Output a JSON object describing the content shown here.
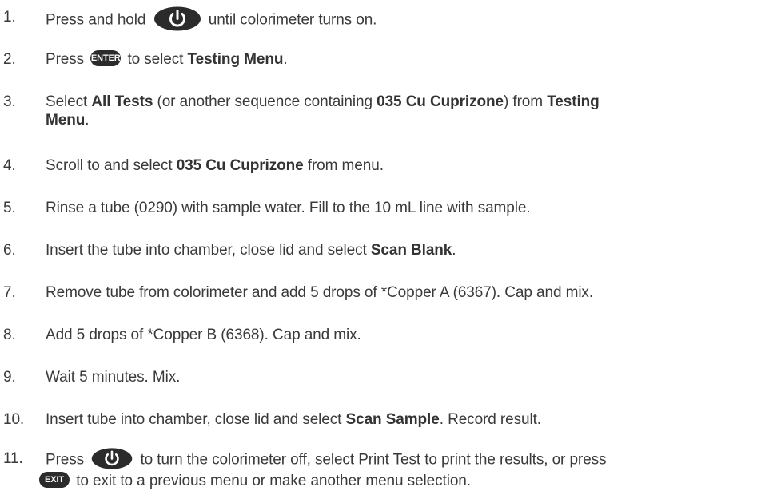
{
  "steps": [
    {
      "num": "1.",
      "a": "Press and hold",
      "b": "until colorimeter turns on."
    },
    {
      "num": "2.",
      "a": "Press",
      "b": "to select",
      "c": "Testing Menu",
      "d": "."
    },
    {
      "num": "3.",
      "a": "Select",
      "b": "All Tests",
      "c": "(or another sequence containing",
      "d": "035 Cu Cuprizone",
      "e": ") from",
      "f": "Testing",
      "g": "Menu",
      "h": "."
    },
    {
      "num": "4.",
      "a": "Scroll to and select",
      "b": "035 Cu Cuprizone",
      "c": "from menu."
    },
    {
      "num": "5.",
      "a": "Rinse a tube (0290) with sample water. Fill to the 10 mL line with sample."
    },
    {
      "num": "6.",
      "a": "Insert the tube into chamber, close lid and select",
      "b": "Scan Blank",
      "c": "."
    },
    {
      "num": "7.",
      "a": "Remove tube from colorimeter and add 5 drops of *Copper A (6367). Cap and mix."
    },
    {
      "num": "8.",
      "a": "Add 5 drops of *Copper B (6368). Cap and mix."
    },
    {
      "num": "9.",
      "a": "Wait 5 minutes. Mix."
    },
    {
      "num": "10.",
      "a": "Insert tube into chamber, close lid and select",
      "b": "Scan Sample",
      "c": ". Record result."
    },
    {
      "num": "11.",
      "a": "Press",
      "b": "to turn the colorimeter off, select Print Test to print the results, or press",
      "c": "to exit to a previous menu or make another menu selection."
    }
  ],
  "buttons": {
    "enter_label": "ENTER",
    "exit_label": "EXIT"
  },
  "colors": {
    "text": "#3a3a3a",
    "button_fill": "#2b2b2b",
    "button_text": "#ffffff"
  },
  "icons": {
    "power": "power-icon"
  }
}
